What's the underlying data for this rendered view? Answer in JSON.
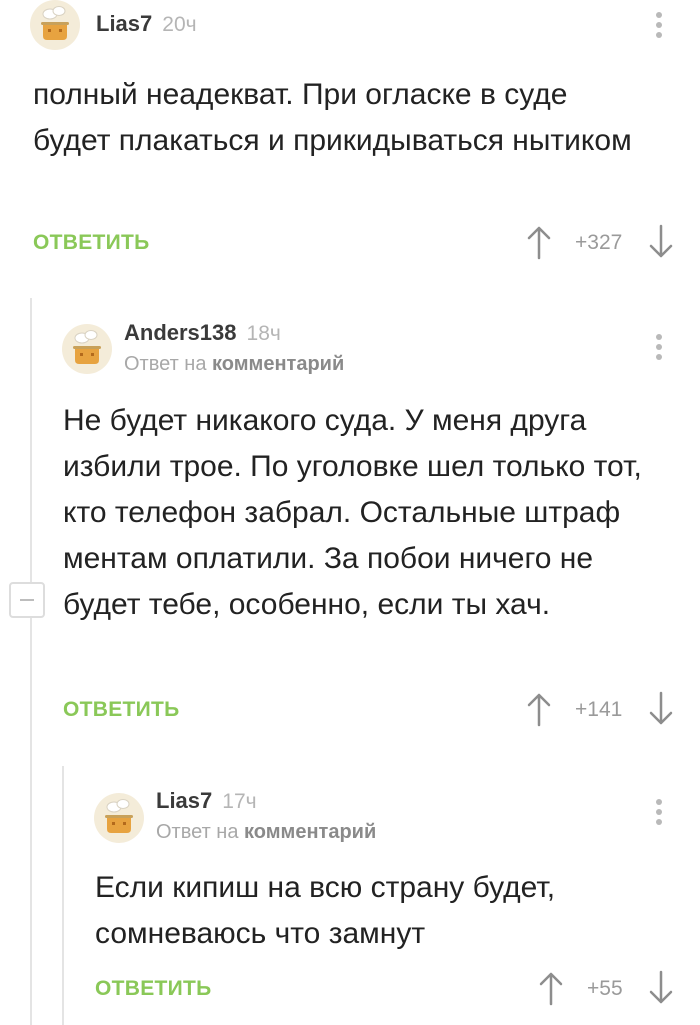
{
  "comments": [
    {
      "author": "Lias7",
      "time": "20ч",
      "text": "полный неадекват. При огласке в суде будет плакаться и прикидываться нытиком",
      "reply_label": "ОТВЕТИТЬ",
      "score": "+327"
    },
    {
      "author": "Anders138",
      "time": "18ч",
      "reply_to_prefix": "Ответ на",
      "reply_to_link": "комментарий",
      "text": "Не будет никакого суда. У меня друга избили трое. По уголовке шел только тот, кто телефон забрал. Остальные штраф ментам оплатили. За побои ничего не будет тебе, особенно, если ты хач.",
      "reply_label": "ОТВЕТИТЬ",
      "score": "+141"
    },
    {
      "author": "Lias7",
      "time": "17ч",
      "reply_to_prefix": "Ответ на",
      "reply_to_link": "комментарий",
      "text": "Если кипиш на всю страну будет, сомневаюсь что замнут",
      "reply_label": "ОТВЕТИТЬ",
      "score": "+55"
    }
  ],
  "icons": {
    "avatar": "cooking-pot-avatar-icon",
    "more": "vertical-dots-icon",
    "upvote": "arrow-up-icon",
    "downvote": "arrow-down-icon",
    "collapse": "minus-icon"
  },
  "colors": {
    "accent_green": "#8ac858",
    "thread_line": "#e4e4e4",
    "meta_gray": "#b5b5b5"
  }
}
